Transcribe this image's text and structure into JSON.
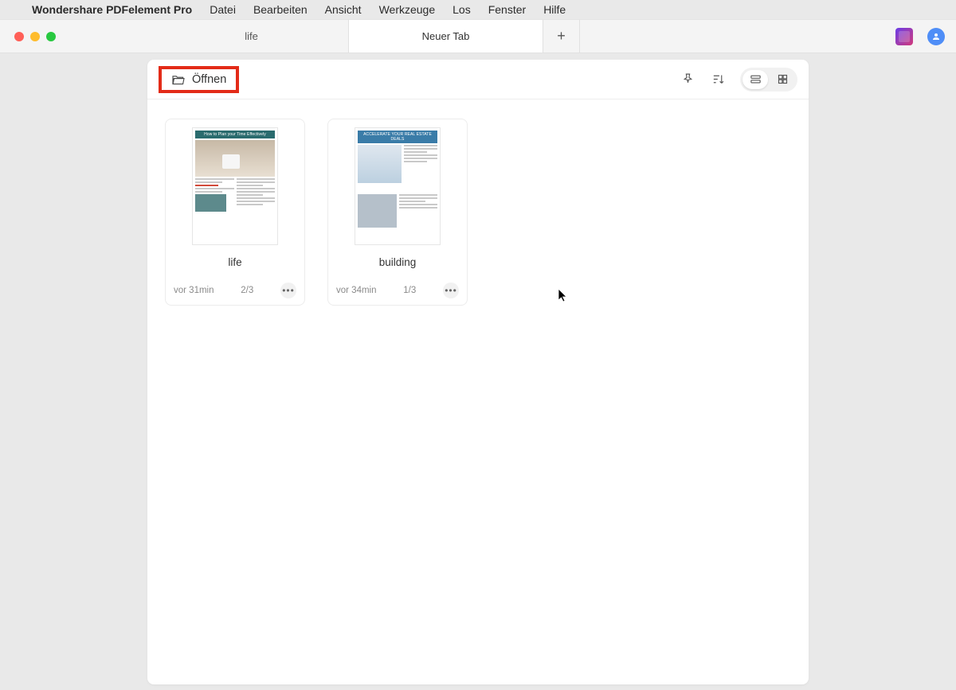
{
  "menubar": {
    "app_name": "Wondershare PDFelement Pro",
    "items": [
      "Datei",
      "Bearbeiten",
      "Ansicht",
      "Werkzeuge",
      "Los",
      "Fenster",
      "Hilfe"
    ]
  },
  "tabs": {
    "items": [
      {
        "label": "life",
        "active": false
      },
      {
        "label": "Neuer Tab",
        "active": true
      }
    ]
  },
  "toolbar": {
    "open_label": "Öffnen"
  },
  "files": [
    {
      "title": "life",
      "time": "vor 31min",
      "pages": "2/3",
      "banner": "How to Plan your Time Effectively"
    },
    {
      "title": "building",
      "time": "vor 34min",
      "pages": "1/3",
      "banner": "ACCELERATE YOUR REAL ESTATE DEALS"
    }
  ]
}
